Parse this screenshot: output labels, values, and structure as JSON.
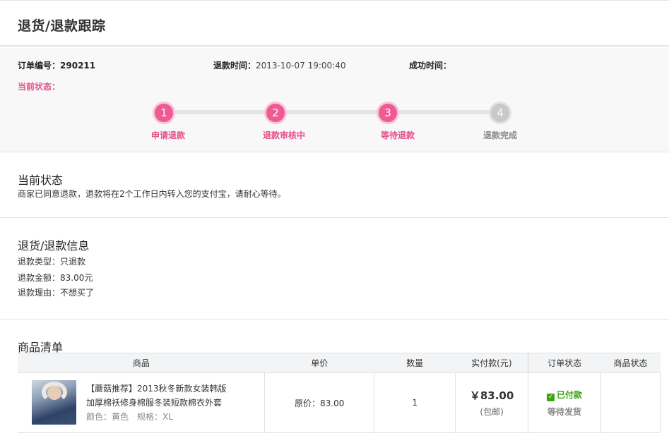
{
  "header": {
    "title": "退货/退款跟踪"
  },
  "order": {
    "number_label": "订单编号：",
    "number_value": "290211",
    "refund_time_label": "退款时间：",
    "refund_time_value": "2013-10-07 19:00:40",
    "success_time_label": "成功时间：",
    "success_time_value": "",
    "current_status_label": "当前状态："
  },
  "steps": [
    {
      "num": "1",
      "label": "申请退款",
      "done": true
    },
    {
      "num": "2",
      "label": "退款审核中",
      "done": true
    },
    {
      "num": "3",
      "label": "等待退款",
      "done": true
    },
    {
      "num": "4",
      "label": "退款完成",
      "done": false
    }
  ],
  "current_status": {
    "title": "当前状态",
    "message": "商家已同意退款，退款将在2个工作日内转入您的支付宝，请耐心等待。"
  },
  "refund_info": {
    "title": "退货/退款信息",
    "type": "退款类型：只退款",
    "amount": "退款金额：83.00元",
    "reason": "退款理由：不想买了"
  },
  "goods": {
    "title": "商品清单",
    "columns": [
      "商品",
      "单价",
      "数量",
      "实付款(元)",
      "订单状态",
      "商品状态"
    ],
    "items": [
      {
        "tag": "【蘑菇推荐】",
        "name_line1": "2013秋冬新款女装韩版",
        "name_line2": "加厚棉袄修身棉服冬装短款棉衣外套",
        "spec": "颜色：黄色　规格：XL",
        "unit_price": "原价：83.00",
        "quantity": "1",
        "paid": "￥83.00",
        "paid_note": "(包邮)",
        "order_status": "已付款",
        "order_substatus": "等待发货",
        "goods_status": ""
      }
    ]
  },
  "colors": {
    "accent": "#ee5b93",
    "accent_text": "#e4508a",
    "success": "#3aa40e",
    "pending": "#c9c9c9"
  },
  "icons": {
    "paid": "check-icon"
  }
}
